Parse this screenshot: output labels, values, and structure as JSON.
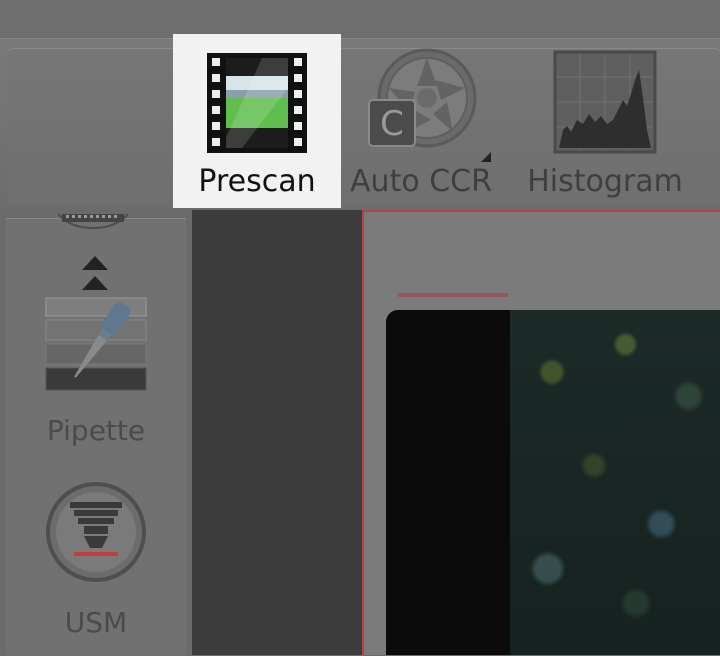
{
  "toolbar": {
    "items": [
      {
        "label": "Prescan",
        "icon": "film-preview-icon",
        "active": true
      },
      {
        "label": "Auto CCR",
        "icon": "auto-ccr-aperture-icon",
        "active": false
      },
      {
        "label": "Histogram",
        "icon": "histogram-icon",
        "active": false
      }
    ]
  },
  "side_panel": {
    "tools": [
      {
        "label": "Pipette",
        "icon": "pipette-icon"
      },
      {
        "label": "USM",
        "icon": "usm-icon"
      }
    ]
  },
  "colors": {
    "active_highlight": "#f2f2f2",
    "frame_border": "#b14545",
    "dark_column": "#3c3c3c"
  }
}
